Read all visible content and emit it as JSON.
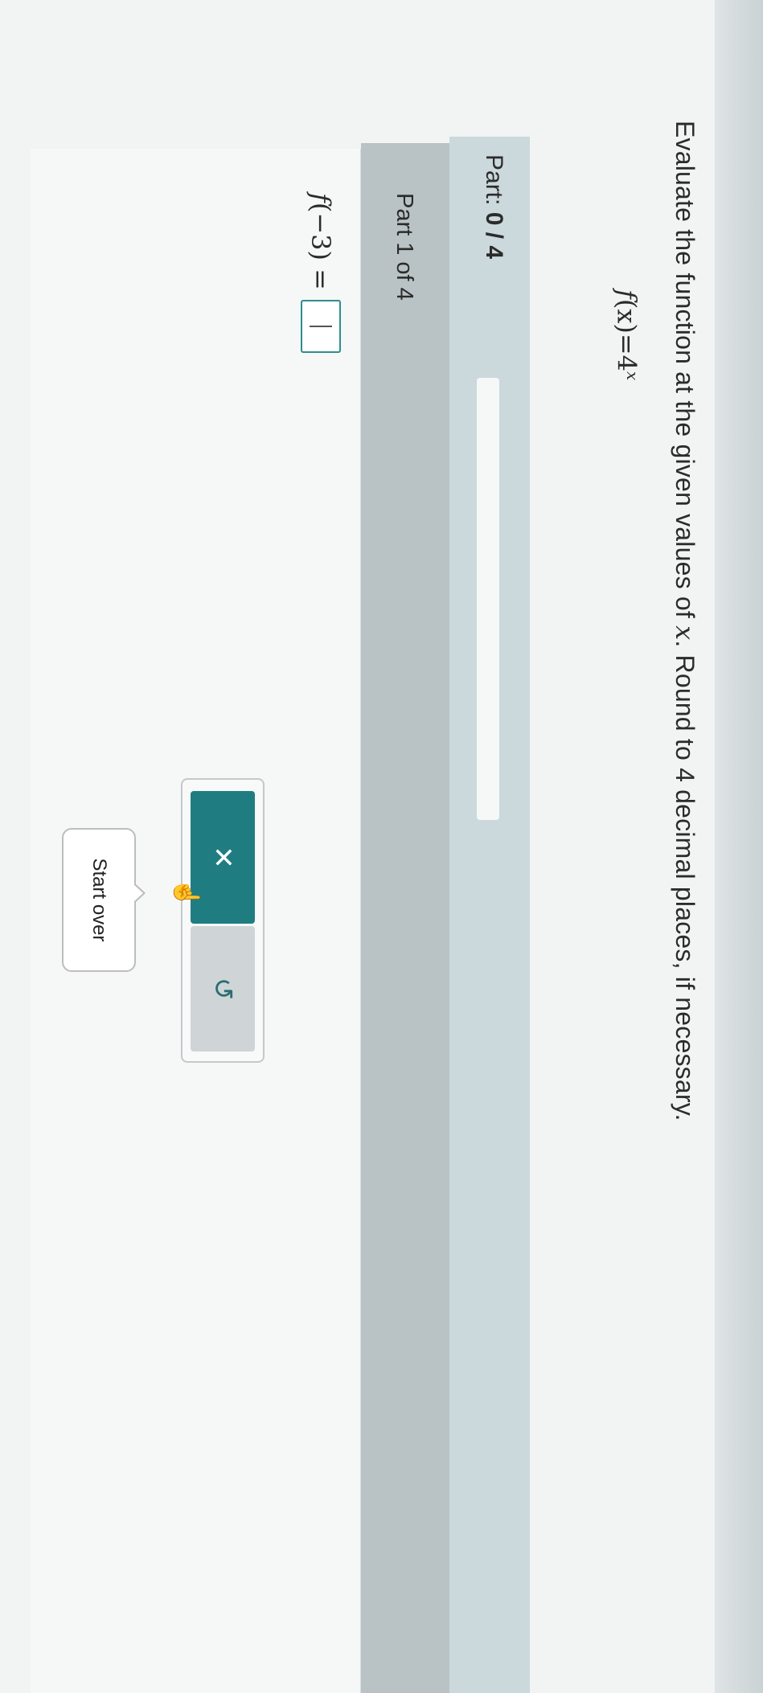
{
  "question": {
    "instruction_before": "Evaluate the function at the given values of ",
    "variable": "x",
    "instruction_after": ". Round to 4 decimal places, if necessary.",
    "function_lhs": "f",
    "function_arg": "(x)",
    "function_eq": "=4",
    "function_exponent": "x"
  },
  "progress": {
    "label": "Part:",
    "score": "0 / 4",
    "completed_fraction": 0
  },
  "part": {
    "label": "Part 1 of 4",
    "answer_lhs_f": "f",
    "answer_lhs_rest": "(−3) =",
    "answer_value": ""
  },
  "toolbar": {
    "clear_icon": "✕",
    "undo_icon": "↺"
  },
  "tooltip": {
    "text": "Start over"
  },
  "icons": {
    "clear": "close-icon",
    "undo": "undo-icon",
    "cursor": "hand-pointer-icon"
  },
  "colors": {
    "accent": "#1f7d82",
    "progress_band": "#cbd8dc"
  }
}
